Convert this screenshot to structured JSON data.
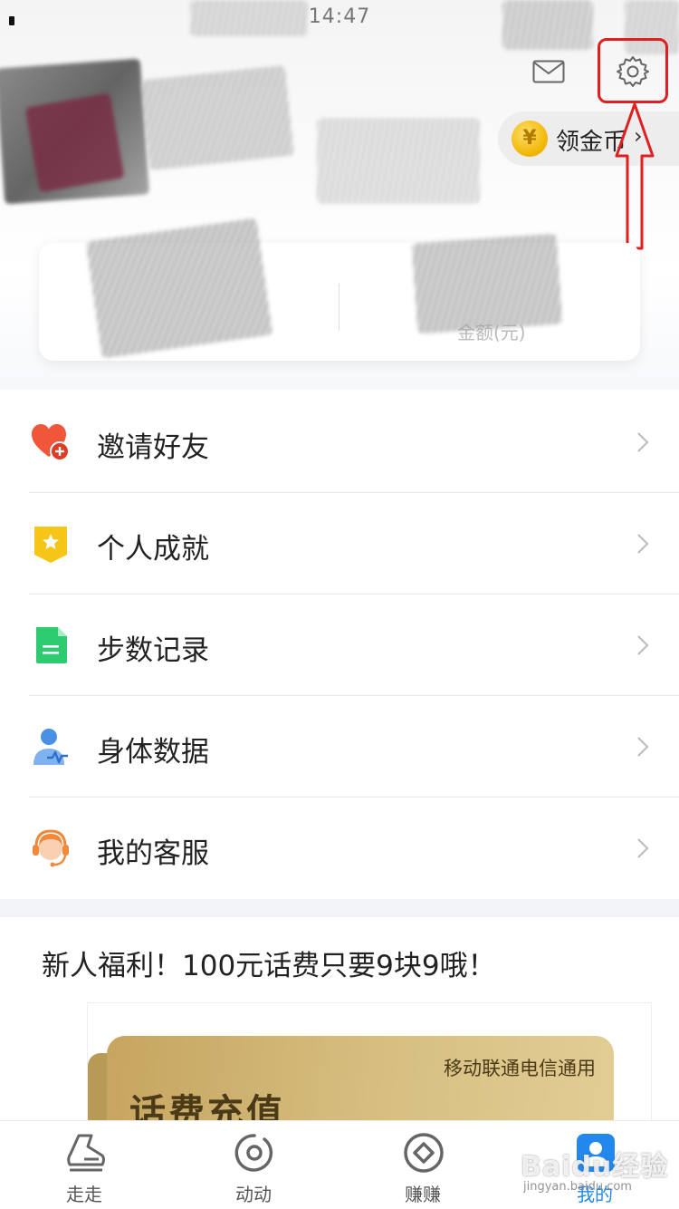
{
  "status_bar": {
    "time": "14:47"
  },
  "header": {
    "coin_button": {
      "label": "领金币",
      "coin_symbol": "¥",
      "chevron": "›"
    },
    "icons": {
      "mail": "mail-icon",
      "settings": "settings-icon"
    },
    "highlight_color": "#e02020"
  },
  "stats_card": {
    "right_label": "金额(元)"
  },
  "menu": {
    "items": [
      {
        "label": "邀请好友",
        "icon": "heart-plus-icon",
        "color": "#f0563a"
      },
      {
        "label": "个人成就",
        "icon": "star-badge-icon",
        "color": "#f5c518"
      },
      {
        "label": "步数记录",
        "icon": "document-icon",
        "color": "#2ecc71"
      },
      {
        "label": "身体数据",
        "icon": "person-pulse-icon",
        "color": "#4a90e2"
      },
      {
        "label": "我的客服",
        "icon": "headset-icon",
        "color": "#f08a3a"
      }
    ]
  },
  "promo": {
    "title": "新人福利！100元话费只要9块9哦！",
    "card_sub": "移动联通电信通用",
    "card_main": "话费充值"
  },
  "tabbar": {
    "tabs": [
      {
        "label": "走走",
        "icon": "shoe-icon",
        "active": false
      },
      {
        "label": "动动",
        "icon": "ring-icon",
        "active": false
      },
      {
        "label": "赚赚",
        "icon": "diamond-icon",
        "active": false
      },
      {
        "label": "我的",
        "icon": "profile-icon",
        "active": true
      }
    ],
    "active_color": "#2288ee"
  },
  "watermark": {
    "text": "Baidu经验",
    "sub": "jingyan.baidu.com"
  }
}
